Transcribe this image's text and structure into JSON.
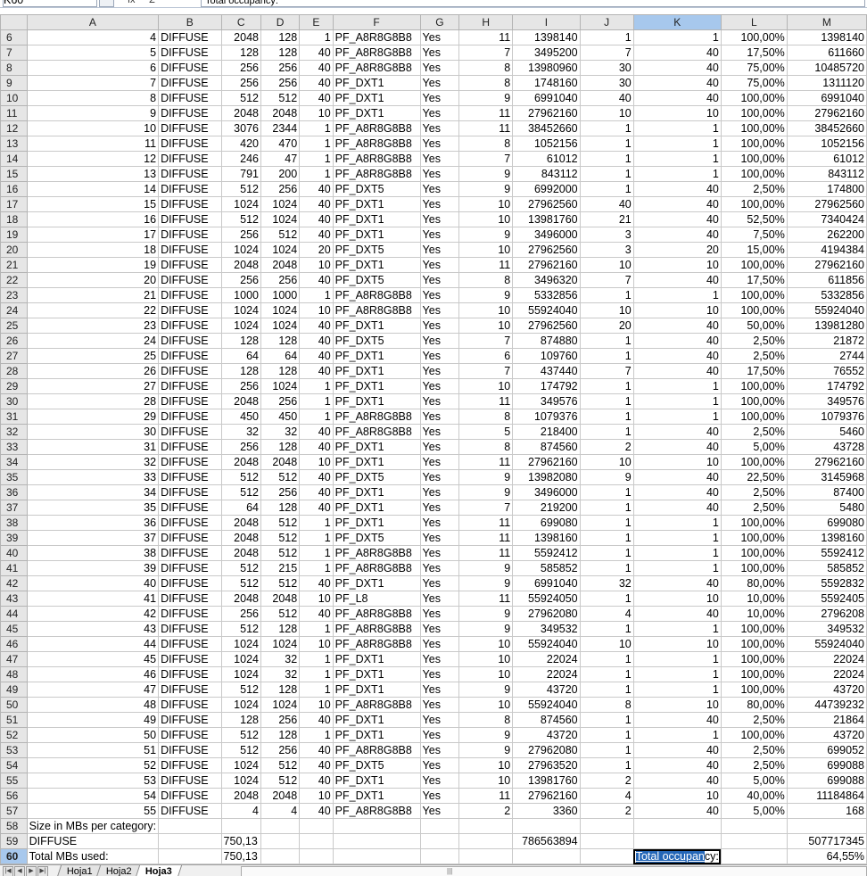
{
  "formula_bar": {
    "name_box": "K60",
    "fx_label": "fx",
    "sum_label": "Σ",
    "content": "Total occupancy:"
  },
  "columns": [
    "A",
    "B",
    "C",
    "D",
    "E",
    "F",
    "G",
    "H",
    "I",
    "J",
    "K",
    "L",
    "M"
  ],
  "selected_column": "K",
  "selected_row": "60",
  "rows": [
    [
      "6",
      "4",
      "DIFFUSE",
      "2048",
      "128",
      "1",
      "PF_A8R8G8B8",
      "Yes",
      "11",
      "1398140",
      "1",
      "1",
      "100,00%",
      "1398140"
    ],
    [
      "7",
      "5",
      "DIFFUSE",
      "128",
      "128",
      "40",
      "PF_A8R8G8B8",
      "Yes",
      "7",
      "3495200",
      "7",
      "40",
      "17,50%",
      "611660"
    ],
    [
      "8",
      "6",
      "DIFFUSE",
      "256",
      "256",
      "40",
      "PF_A8R8G8B8",
      "Yes",
      "8",
      "13980960",
      "30",
      "40",
      "75,00%",
      "10485720"
    ],
    [
      "9",
      "7",
      "DIFFUSE",
      "256",
      "256",
      "40",
      "PF_DXT1",
      "Yes",
      "8",
      "1748160",
      "30",
      "40",
      "75,00%",
      "1311120"
    ],
    [
      "10",
      "8",
      "DIFFUSE",
      "512",
      "512",
      "40",
      "PF_DXT1",
      "Yes",
      "9",
      "6991040",
      "40",
      "40",
      "100,00%",
      "6991040"
    ],
    [
      "11",
      "9",
      "DIFFUSE",
      "2048",
      "2048",
      "10",
      "PF_DXT1",
      "Yes",
      "11",
      "27962160",
      "10",
      "10",
      "100,00%",
      "27962160"
    ],
    [
      "12",
      "10",
      "DIFFUSE",
      "3076",
      "2344",
      "1",
      "PF_A8R8G8B8",
      "Yes",
      "11",
      "38452660",
      "1",
      "1",
      "100,00%",
      "38452660"
    ],
    [
      "13",
      "11",
      "DIFFUSE",
      "420",
      "470",
      "1",
      "PF_A8R8G8B8",
      "Yes",
      "8",
      "1052156",
      "1",
      "1",
      "100,00%",
      "1052156"
    ],
    [
      "14",
      "12",
      "DIFFUSE",
      "246",
      "47",
      "1",
      "PF_A8R8G8B8",
      "Yes",
      "7",
      "61012",
      "1",
      "1",
      "100,00%",
      "61012"
    ],
    [
      "15",
      "13",
      "DIFFUSE",
      "791",
      "200",
      "1",
      "PF_A8R8G8B8",
      "Yes",
      "9",
      "843112",
      "1",
      "1",
      "100,00%",
      "843112"
    ],
    [
      "16",
      "14",
      "DIFFUSE",
      "512",
      "256",
      "40",
      "PF_DXT5",
      "Yes",
      "9",
      "6992000",
      "1",
      "40",
      "2,50%",
      "174800"
    ],
    [
      "17",
      "15",
      "DIFFUSE",
      "1024",
      "1024",
      "40",
      "PF_DXT1",
      "Yes",
      "10",
      "27962560",
      "40",
      "40",
      "100,00%",
      "27962560"
    ],
    [
      "18",
      "16",
      "DIFFUSE",
      "512",
      "1024",
      "40",
      "PF_DXT1",
      "Yes",
      "10",
      "13981760",
      "21",
      "40",
      "52,50%",
      "7340424"
    ],
    [
      "19",
      "17",
      "DIFFUSE",
      "256",
      "512",
      "40",
      "PF_DXT1",
      "Yes",
      "9",
      "3496000",
      "3",
      "40",
      "7,50%",
      "262200"
    ],
    [
      "20",
      "18",
      "DIFFUSE",
      "1024",
      "1024",
      "20",
      "PF_DXT5",
      "Yes",
      "10",
      "27962560",
      "3",
      "20",
      "15,00%",
      "4194384"
    ],
    [
      "21",
      "19",
      "DIFFUSE",
      "2048",
      "2048",
      "10",
      "PF_DXT1",
      "Yes",
      "11",
      "27962160",
      "10",
      "10",
      "100,00%",
      "27962160"
    ],
    [
      "22",
      "20",
      "DIFFUSE",
      "256",
      "256",
      "40",
      "PF_DXT5",
      "Yes",
      "8",
      "3496320",
      "7",
      "40",
      "17,50%",
      "611856"
    ],
    [
      "23",
      "21",
      "DIFFUSE",
      "1000",
      "1000",
      "1",
      "PF_A8R8G8B8",
      "Yes",
      "9",
      "5332856",
      "1",
      "1",
      "100,00%",
      "5332856"
    ],
    [
      "24",
      "22",
      "DIFFUSE",
      "1024",
      "1024",
      "10",
      "PF_A8R8G8B8",
      "Yes",
      "10",
      "55924040",
      "10",
      "10",
      "100,00%",
      "55924040"
    ],
    [
      "25",
      "23",
      "DIFFUSE",
      "1024",
      "1024",
      "40",
      "PF_DXT1",
      "Yes",
      "10",
      "27962560",
      "20",
      "40",
      "50,00%",
      "13981280"
    ],
    [
      "26",
      "24",
      "DIFFUSE",
      "128",
      "128",
      "40",
      "PF_DXT5",
      "Yes",
      "7",
      "874880",
      "1",
      "40",
      "2,50%",
      "21872"
    ],
    [
      "27",
      "25",
      "DIFFUSE",
      "64",
      "64",
      "40",
      "PF_DXT1",
      "Yes",
      "6",
      "109760",
      "1",
      "40",
      "2,50%",
      "2744"
    ],
    [
      "28",
      "26",
      "DIFFUSE",
      "128",
      "128",
      "40",
      "PF_DXT1",
      "Yes",
      "7",
      "437440",
      "7",
      "40",
      "17,50%",
      "76552"
    ],
    [
      "29",
      "27",
      "DIFFUSE",
      "256",
      "1024",
      "1",
      "PF_DXT1",
      "Yes",
      "10",
      "174792",
      "1",
      "1",
      "100,00%",
      "174792"
    ],
    [
      "30",
      "28",
      "DIFFUSE",
      "2048",
      "256",
      "1",
      "PF_DXT1",
      "Yes",
      "11",
      "349576",
      "1",
      "1",
      "100,00%",
      "349576"
    ],
    [
      "31",
      "29",
      "DIFFUSE",
      "450",
      "450",
      "1",
      "PF_A8R8G8B8",
      "Yes",
      "8",
      "1079376",
      "1",
      "1",
      "100,00%",
      "1079376"
    ],
    [
      "32",
      "30",
      "DIFFUSE",
      "32",
      "32",
      "40",
      "PF_A8R8G8B8",
      "Yes",
      "5",
      "218400",
      "1",
      "40",
      "2,50%",
      "5460"
    ],
    [
      "33",
      "31",
      "DIFFUSE",
      "256",
      "128",
      "40",
      "PF_DXT1",
      "Yes",
      "8",
      "874560",
      "2",
      "40",
      "5,00%",
      "43728"
    ],
    [
      "34",
      "32",
      "DIFFUSE",
      "2048",
      "2048",
      "10",
      "PF_DXT1",
      "Yes",
      "11",
      "27962160",
      "10",
      "10",
      "100,00%",
      "27962160"
    ],
    [
      "35",
      "33",
      "DIFFUSE",
      "512",
      "512",
      "40",
      "PF_DXT5",
      "Yes",
      "9",
      "13982080",
      "9",
      "40",
      "22,50%",
      "3145968"
    ],
    [
      "36",
      "34",
      "DIFFUSE",
      "512",
      "256",
      "40",
      "PF_DXT1",
      "Yes",
      "9",
      "3496000",
      "1",
      "40",
      "2,50%",
      "87400"
    ],
    [
      "37",
      "35",
      "DIFFUSE",
      "64",
      "128",
      "40",
      "PF_DXT1",
      "Yes",
      "7",
      "219200",
      "1",
      "40",
      "2,50%",
      "5480"
    ],
    [
      "38",
      "36",
      "DIFFUSE",
      "2048",
      "512",
      "1",
      "PF_DXT1",
      "Yes",
      "11",
      "699080",
      "1",
      "1",
      "100,00%",
      "699080"
    ],
    [
      "39",
      "37",
      "DIFFUSE",
      "2048",
      "512",
      "1",
      "PF_DXT5",
      "Yes",
      "11",
      "1398160",
      "1",
      "1",
      "100,00%",
      "1398160"
    ],
    [
      "40",
      "38",
      "DIFFUSE",
      "2048",
      "512",
      "1",
      "PF_A8R8G8B8",
      "Yes",
      "11",
      "5592412",
      "1",
      "1",
      "100,00%",
      "5592412"
    ],
    [
      "41",
      "39",
      "DIFFUSE",
      "512",
      "215",
      "1",
      "PF_A8R8G8B8",
      "Yes",
      "9",
      "585852",
      "1",
      "1",
      "100,00%",
      "585852"
    ],
    [
      "42",
      "40",
      "DIFFUSE",
      "512",
      "512",
      "40",
      "PF_DXT1",
      "Yes",
      "9",
      "6991040",
      "32",
      "40",
      "80,00%",
      "5592832"
    ],
    [
      "43",
      "41",
      "DIFFUSE",
      "2048",
      "2048",
      "10",
      "PF_L8",
      "Yes",
      "11",
      "55924050",
      "1",
      "10",
      "10,00%",
      "5592405"
    ],
    [
      "44",
      "42",
      "DIFFUSE",
      "256",
      "512",
      "40",
      "PF_A8R8G8B8",
      "Yes",
      "9",
      "27962080",
      "4",
      "40",
      "10,00%",
      "2796208"
    ],
    [
      "45",
      "43",
      "DIFFUSE",
      "512",
      "128",
      "1",
      "PF_A8R8G8B8",
      "Yes",
      "9",
      "349532",
      "1",
      "1",
      "100,00%",
      "349532"
    ],
    [
      "46",
      "44",
      "DIFFUSE",
      "1024",
      "1024",
      "10",
      "PF_A8R8G8B8",
      "Yes",
      "10",
      "55924040",
      "10",
      "10",
      "100,00%",
      "55924040"
    ],
    [
      "47",
      "45",
      "DIFFUSE",
      "1024",
      "32",
      "1",
      "PF_DXT1",
      "Yes",
      "10",
      "22024",
      "1",
      "1",
      "100,00%",
      "22024"
    ],
    [
      "48",
      "46",
      "DIFFUSE",
      "1024",
      "32",
      "1",
      "PF_DXT1",
      "Yes",
      "10",
      "22024",
      "1",
      "1",
      "100,00%",
      "22024"
    ],
    [
      "49",
      "47",
      "DIFFUSE",
      "512",
      "128",
      "1",
      "PF_DXT1",
      "Yes",
      "9",
      "43720",
      "1",
      "1",
      "100,00%",
      "43720"
    ],
    [
      "50",
      "48",
      "DIFFUSE",
      "1024",
      "1024",
      "10",
      "PF_A8R8G8B8",
      "Yes",
      "10",
      "55924040",
      "8",
      "10",
      "80,00%",
      "44739232"
    ],
    [
      "51",
      "49",
      "DIFFUSE",
      "128",
      "256",
      "40",
      "PF_DXT1",
      "Yes",
      "8",
      "874560",
      "1",
      "40",
      "2,50%",
      "21864"
    ],
    [
      "52",
      "50",
      "DIFFUSE",
      "512",
      "128",
      "1",
      "PF_DXT1",
      "Yes",
      "9",
      "43720",
      "1",
      "1",
      "100,00%",
      "43720"
    ],
    [
      "53",
      "51",
      "DIFFUSE",
      "512",
      "256",
      "40",
      "PF_A8R8G8B8",
      "Yes",
      "9",
      "27962080",
      "1",
      "40",
      "2,50%",
      "699052"
    ],
    [
      "54",
      "52",
      "DIFFUSE",
      "1024",
      "512",
      "40",
      "PF_DXT5",
      "Yes",
      "10",
      "27963520",
      "1",
      "40",
      "2,50%",
      "699088"
    ],
    [
      "55",
      "53",
      "DIFFUSE",
      "1024",
      "512",
      "40",
      "PF_DXT1",
      "Yes",
      "10",
      "13981760",
      "2",
      "40",
      "5,00%",
      "699088"
    ],
    [
      "56",
      "54",
      "DIFFUSE",
      "2048",
      "2048",
      "10",
      "PF_DXT1",
      "Yes",
      "11",
      "27962160",
      "4",
      "10",
      "40,00%",
      "11184864"
    ],
    [
      "57",
      "55",
      "DIFFUSE",
      "4",
      "4",
      "40",
      "PF_A8R8G8B8",
      "Yes",
      "2",
      "3360",
      "2",
      "40",
      "5,00%",
      "168"
    ]
  ],
  "summary": {
    "r58": {
      "row": "58",
      "a": "Size in MBs per category:"
    },
    "r59": {
      "row": "59",
      "a": "DIFFUSE",
      "c": "750,13",
      "i": "786563894",
      "m": "507717345"
    },
    "r60": {
      "row": "60",
      "a": "Total MBs used:",
      "c": "750,13",
      "k_pre": "Total occupan",
      "k_post": "cy:",
      "m": "64,55%"
    }
  },
  "sheet_tabs": [
    "Hoja1",
    "Hoja2",
    "Hoja3"
  ],
  "active_tab": "Hoja3"
}
